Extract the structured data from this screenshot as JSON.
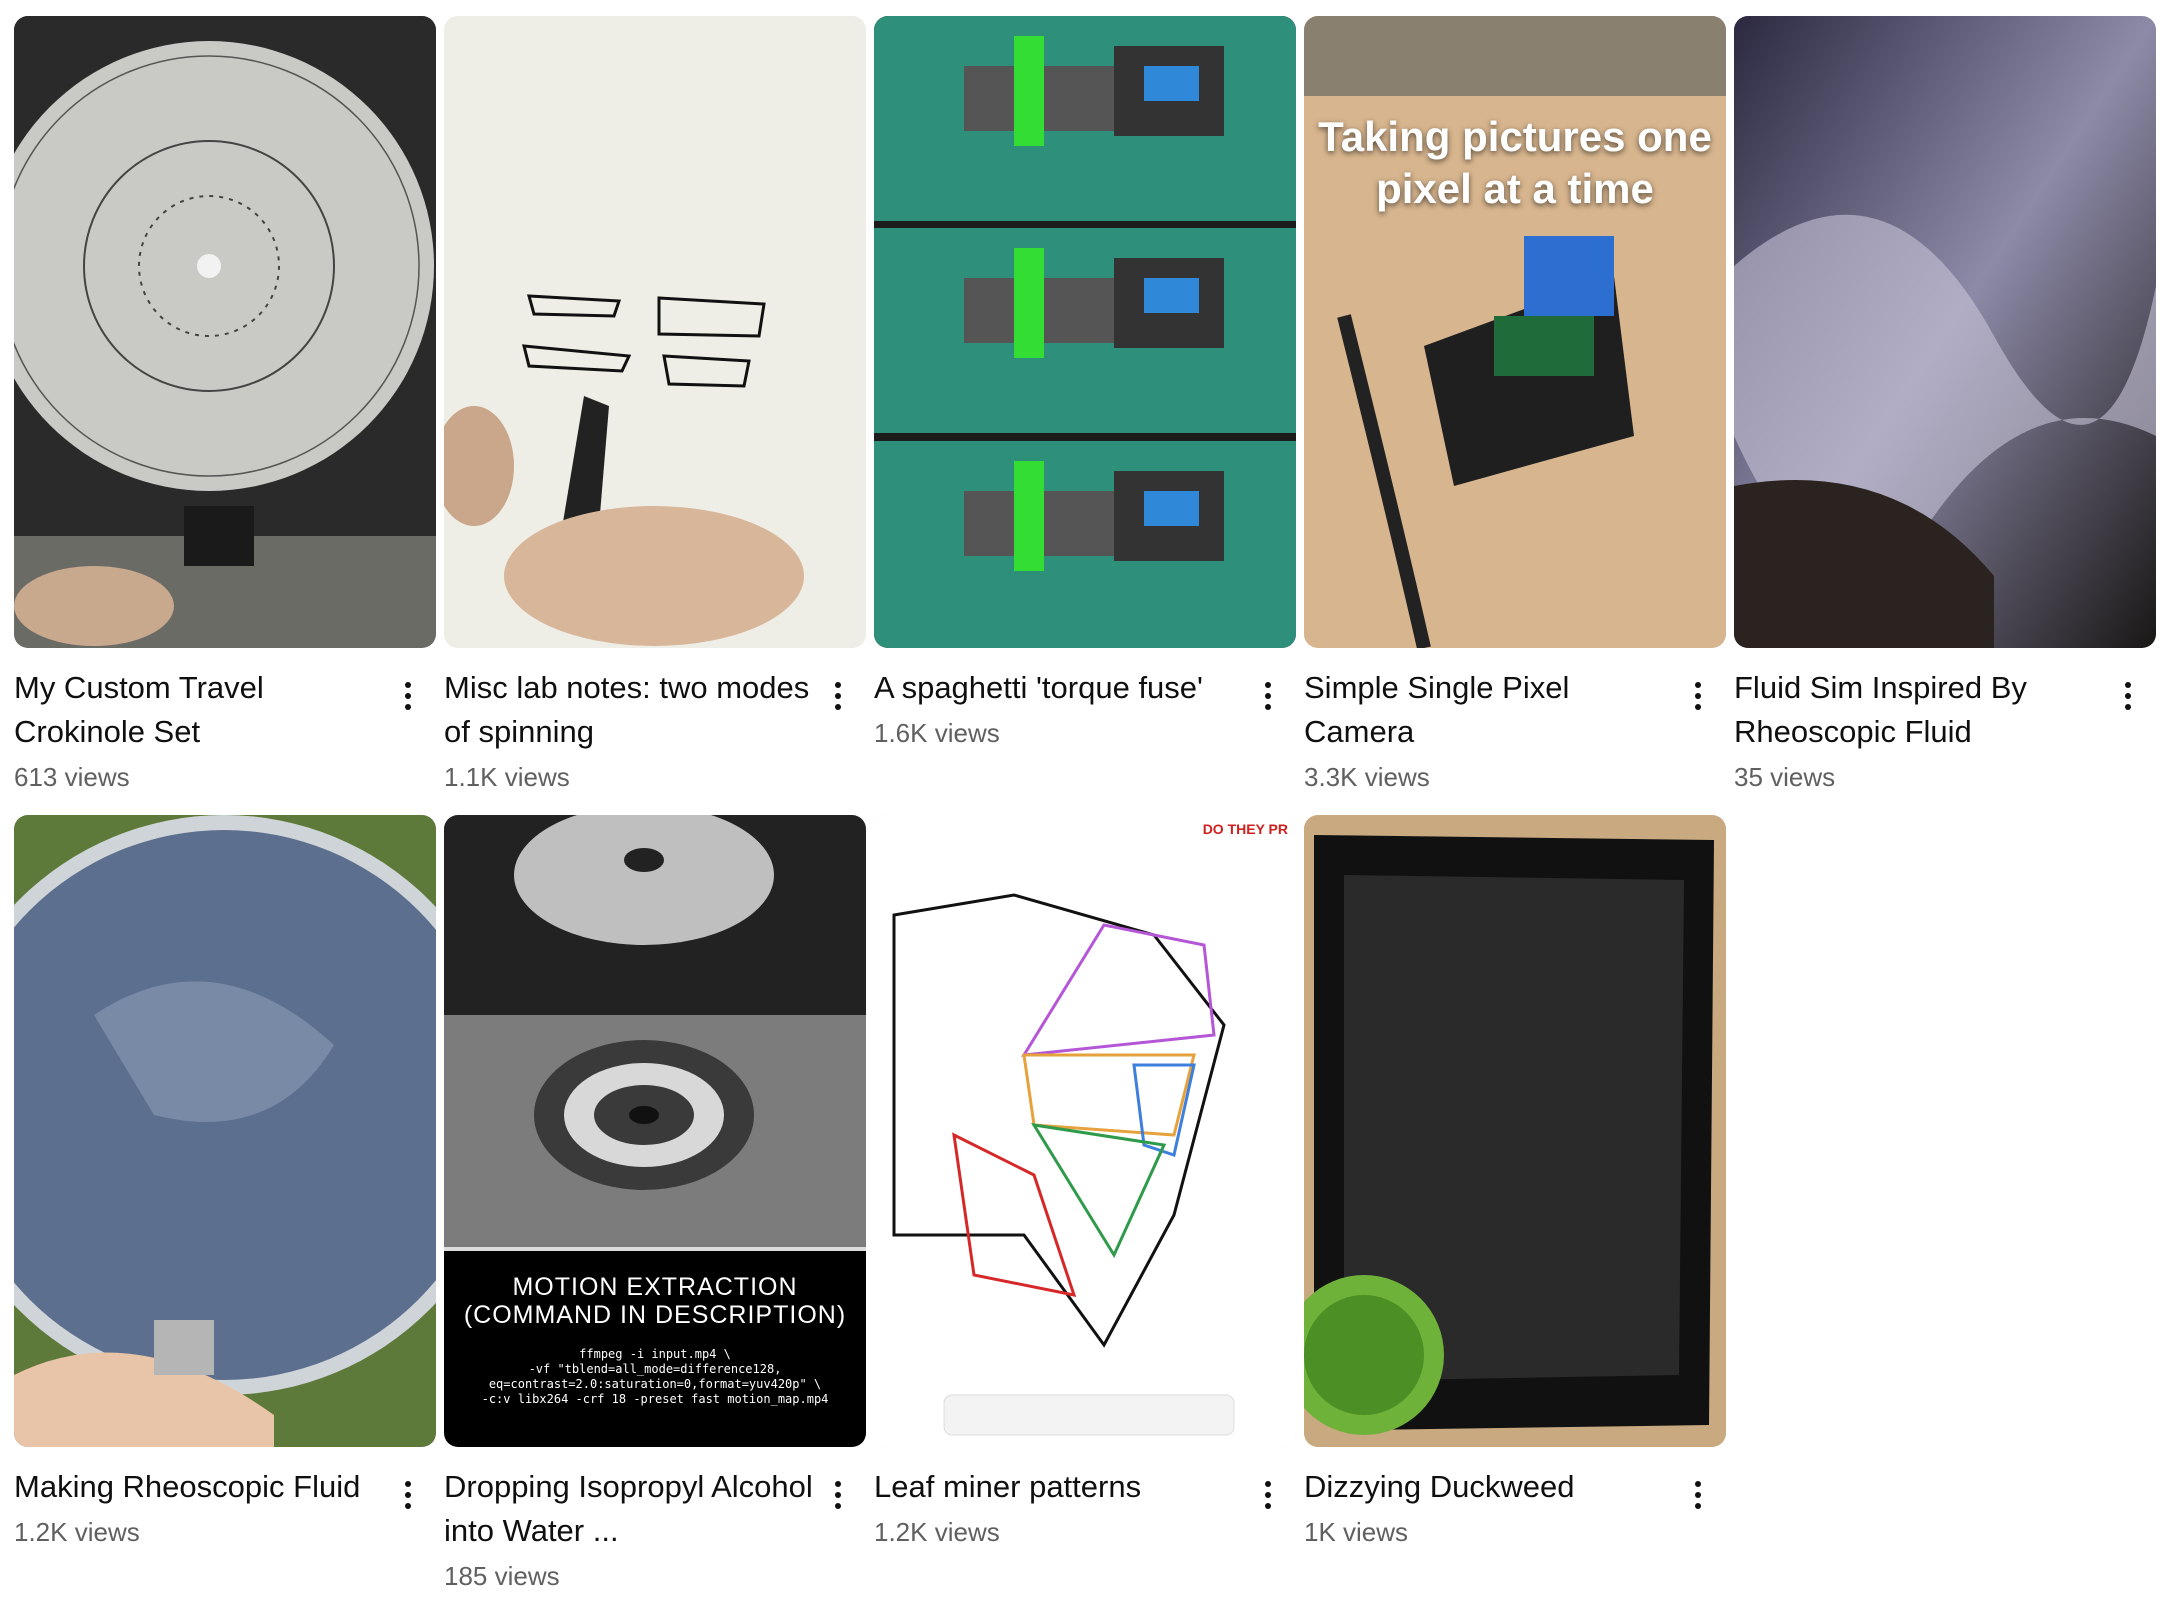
{
  "videos": [
    {
      "title": "My Custom Travel Crokinole Set",
      "views": "613 views"
    },
    {
      "title": "Misc lab notes: two modes of spinning",
      "views": "1.1K views"
    },
    {
      "title": "A spaghetti 'torque fuse'",
      "views": "1.6K views"
    },
    {
      "title": "Simple Single Pixel Camera",
      "views": "3.3K views",
      "overlay": "Taking pictures one pixel at a time"
    },
    {
      "title": "Fluid Sim Inspired By Rheoscopic Fluid",
      "views": "35 views"
    },
    {
      "title": "Making Rheoscopic Fluid",
      "views": "1.2K views"
    },
    {
      "title": "Dropping Isopropyl Alcohol into Water ...",
      "views": "185 views",
      "overlay": "MOTION EXTRACTION (COMMAND IN DESCRIPTION)",
      "overlay_code": "ffmpeg -i input.mp4 \\\n-vf \"tblend=all_mode=difference128,\neq=contrast=2.0:saturation=0,format=yuv420p\" \\\n-c:v libx264 -crf 18 -preset fast motion_map.mp4"
    },
    {
      "title": "Leaf miner patterns",
      "views": "1.2K views",
      "overlay": "DO THEY PR"
    },
    {
      "title": "Dizzying Duckweed",
      "views": "1K views"
    }
  ],
  "icons": {
    "menu": "more-vert-icon"
  }
}
